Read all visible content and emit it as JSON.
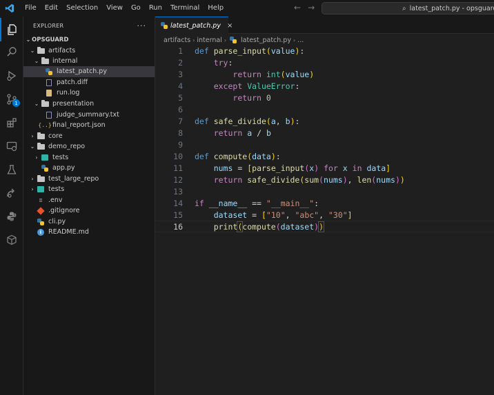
{
  "titlebar": {
    "menu": [
      "File",
      "Edit",
      "Selection",
      "View",
      "Go",
      "Run",
      "Terminal",
      "Help"
    ],
    "search_text": "latest_patch.py - opsguard - Visual Studio Code"
  },
  "activitybar": {
    "items": [
      "explorer",
      "search",
      "run-and-debug",
      "source-control",
      "extensions",
      "remote-explorer",
      "testing",
      "live-share",
      "python",
      "containers"
    ],
    "source_control_badge": "1"
  },
  "sidebar": {
    "header": "EXPLORER",
    "more": "···",
    "tree": [
      {
        "label": "OPSGUARD",
        "type": "root"
      },
      {
        "label": "artifacts",
        "type": "folder",
        "open": true
      },
      {
        "label": "internal",
        "type": "folder",
        "open": true
      },
      {
        "label": "latest_patch.py",
        "type": "py",
        "selected": true
      },
      {
        "label": "patch.diff",
        "type": "txt"
      },
      {
        "label": "run.log",
        "type": "log"
      },
      {
        "label": "presentation",
        "type": "folder",
        "open": true
      },
      {
        "label": "judge_summary.txt",
        "type": "txt"
      },
      {
        "label": "final_report.json",
        "type": "json"
      },
      {
        "label": "core",
        "type": "folder",
        "open": false
      },
      {
        "label": "demo_repo",
        "type": "folder",
        "open": true
      },
      {
        "label": "tests",
        "type": "tests",
        "open": false
      },
      {
        "label": "app.py",
        "type": "py"
      },
      {
        "label": "test_large_repo",
        "type": "folder",
        "open": false
      },
      {
        "label": "tests",
        "type": "tests",
        "open": false
      },
      {
        "label": ".env",
        "type": "env"
      },
      {
        "label": ".gitignore",
        "type": "git"
      },
      {
        "label": "cli.py",
        "type": "py"
      },
      {
        "label": "README.md",
        "type": "info"
      }
    ]
  },
  "editor": {
    "tab_label": "latest_patch.py",
    "tab_close": "×",
    "breadcrumb": [
      "artifacts",
      "internal",
      "latest_patch.py",
      "..."
    ],
    "line_numbers": [
      "1",
      "2",
      "3",
      "4",
      "5",
      "6",
      "7",
      "8",
      "9",
      "10",
      "11",
      "12",
      "13",
      "14",
      "15",
      "16"
    ],
    "current_line": 16,
    "code_lines": [
      "def parse_input(value):",
      "    try:",
      "        return int(value)",
      "    except ValueError:",
      "        return 0",
      "",
      "def safe_divide(a, b):",
      "    return a / b",
      "",
      "def compute(data):",
      "    nums = [parse_input(x) for x in data]",
      "    return safe_divide(sum(nums), len(nums))",
      "",
      "if __name__ == \"__main__\":",
      "    dataset = [\"10\", \"abc\", \"30\"]",
      "    print(compute(dataset))"
    ]
  },
  "colors": {
    "accent": "#0078d4",
    "keyword": "#569cd6",
    "control": "#c586c0",
    "function": "#dcdcaa",
    "variable": "#9cdcfe",
    "string": "#ce9178",
    "number": "#b5cea8",
    "class": "#4ec9b0"
  }
}
